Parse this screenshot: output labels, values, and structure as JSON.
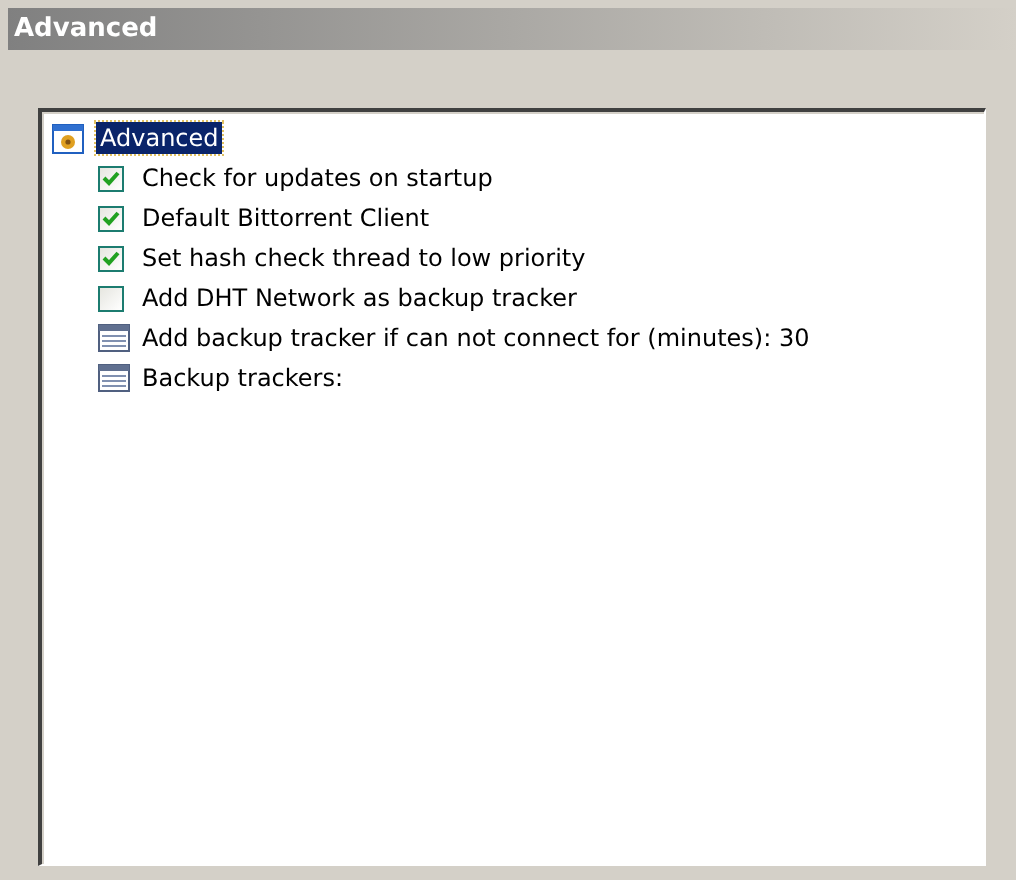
{
  "header": {
    "title": "Advanced"
  },
  "tree": {
    "root": {
      "label": "Advanced",
      "selected": true
    },
    "items": [
      {
        "kind": "checkbox",
        "label": "Check for updates on startup",
        "checked": true
      },
      {
        "kind": "checkbox",
        "label": "Default Bittorrent Client",
        "checked": true
      },
      {
        "kind": "checkbox",
        "label": "Set hash check thread to low priority",
        "checked": true
      },
      {
        "kind": "checkbox",
        "label": "Add DHT Network as backup tracker",
        "checked": false
      },
      {
        "kind": "field",
        "label": "Add backup tracker if can not connect for (minutes): 30"
      },
      {
        "kind": "field",
        "label": "Backup trackers:"
      }
    ]
  }
}
